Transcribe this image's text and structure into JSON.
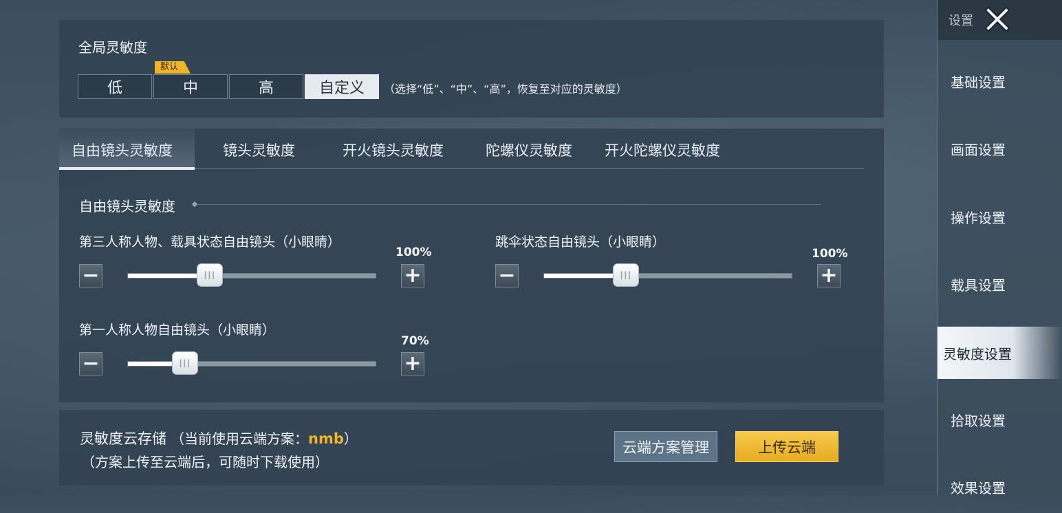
{
  "global": {
    "title": "全局灵敏度",
    "default_badge": "默认",
    "presets": [
      "低",
      "中",
      "高",
      "自定义"
    ],
    "selected_preset": "自定义",
    "hint": "（选择“低”、“中”、“高”，恢复至对应的灵敏度）"
  },
  "tabs": [
    "自由镜头灵敏度",
    "镜头灵敏度",
    "开火镜头灵敏度",
    "陀螺仪灵敏度",
    "开火陀螺仪灵敏度"
  ],
  "active_tab": "自由镜头灵敏度",
  "section": {
    "title": "自由镜头灵敏度",
    "sliders": [
      {
        "label": "第三人称人物、载具状态自由镜头（小眼睛）",
        "value": 100,
        "value_text": "100%",
        "fill_fraction": 0.33
      },
      {
        "label": "跳伞状态自由镜头（小眼睛）",
        "value": 100,
        "value_text": "100%",
        "fill_fraction": 0.33
      },
      {
        "label": "第一人称人物自由镜头（小眼睛）",
        "value": 70,
        "value_text": "70%",
        "fill_fraction": 0.23
      }
    ],
    "thumb_grip": "III",
    "minus": "−",
    "plus": "+"
  },
  "cloud": {
    "title": "灵敏度云存储",
    "current_prefix": "（当前使用云端方案：",
    "scheme_name": "nmb",
    "current_suffix": "）",
    "note": "（方案上传至云端后，可随时下载使用）",
    "manage_button": "云端方案管理",
    "upload_button": "上传云端"
  },
  "sidebar": {
    "header": "设置",
    "items": [
      "基础设置",
      "画面设置",
      "操作设置",
      "载具设置",
      "灵敏度设置",
      "拾取设置",
      "效果设置"
    ],
    "active": "灵敏度设置"
  },
  "colors": {
    "accent": "#f0b429",
    "panel": "#324252",
    "selected": "#e6ebf0"
  },
  "icons": {
    "close": "close-icon"
  }
}
